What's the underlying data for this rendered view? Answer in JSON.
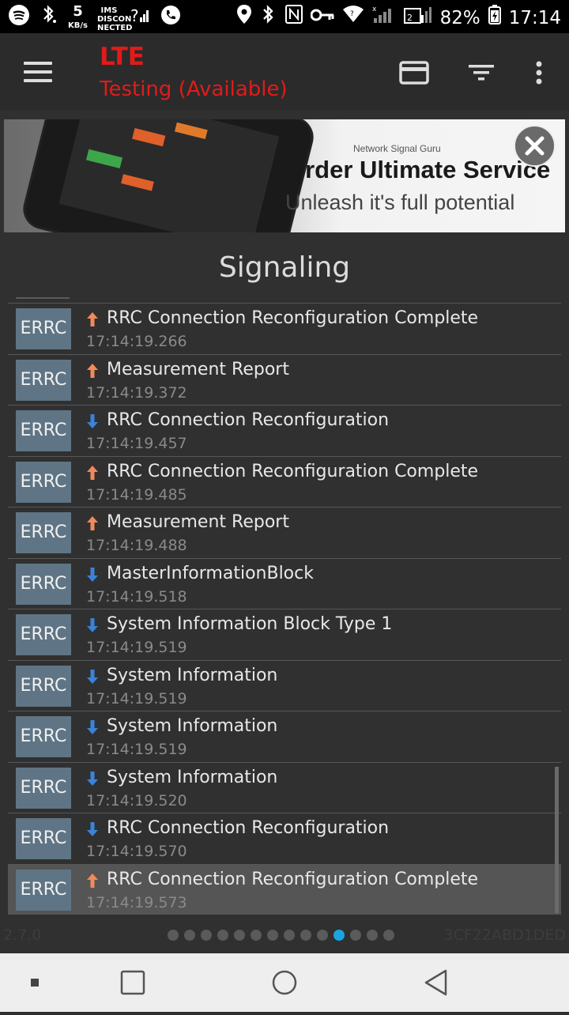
{
  "status_bar": {
    "speed_value": "5",
    "speed_unit": "KB/s",
    "ims_label": "IMS DISCON NECTED",
    "battery": "82%",
    "time": "17:14"
  },
  "app_bar": {
    "title": "LTE",
    "subtitle": "Testing (Available)"
  },
  "banner": {
    "brand": "Network Signal Guru",
    "headline": "Order Ultimate Service",
    "tagline": "Unleash it's full potential"
  },
  "section_title": "Signaling",
  "messages": [
    {
      "badge": "ERRC",
      "direction": "up",
      "text": "RRC Connection Reconfiguration Complete",
      "time": "17:14:19.266"
    },
    {
      "badge": "ERRC",
      "direction": "up",
      "text": "Measurement Report",
      "time": "17:14:19.372"
    },
    {
      "badge": "ERRC",
      "direction": "down",
      "text": "RRC Connection Reconfiguration",
      "time": "17:14:19.457"
    },
    {
      "badge": "ERRC",
      "direction": "up",
      "text": "RRC Connection Reconfiguration Complete",
      "time": "17:14:19.485"
    },
    {
      "badge": "ERRC",
      "direction": "up",
      "text": "Measurement Report",
      "time": "17:14:19.488"
    },
    {
      "badge": "ERRC",
      "direction": "down",
      "text": "MasterInformationBlock",
      "time": "17:14:19.518"
    },
    {
      "badge": "ERRC",
      "direction": "down",
      "text": "System Information Block Type 1",
      "time": "17:14:19.519"
    },
    {
      "badge": "ERRC",
      "direction": "down",
      "text": "System Information",
      "time": "17:14:19.519"
    },
    {
      "badge": "ERRC",
      "direction": "down",
      "text": "System Information",
      "time": "17:14:19.519"
    },
    {
      "badge": "ERRC",
      "direction": "down",
      "text": "System Information",
      "time": "17:14:19.520"
    },
    {
      "badge": "ERRC",
      "direction": "down",
      "text": "RRC Connection Reconfiguration",
      "time": "17:14:19.570"
    },
    {
      "badge": "ERRC",
      "direction": "up",
      "text": "RRC Connection Reconfiguration Complete",
      "time": "17:14:19.573",
      "selected": true
    }
  ],
  "footer": {
    "version": "2.7.0",
    "device_code": "3CF22ABD1DED",
    "page_count": 14,
    "active_page": 11
  },
  "colors": {
    "accent_red": "#e11b1b",
    "up_arrow": "#f08a5d",
    "down_arrow": "#3b82d9",
    "badge_bg": "#5f7585",
    "active_dot": "#1aa6e0"
  }
}
